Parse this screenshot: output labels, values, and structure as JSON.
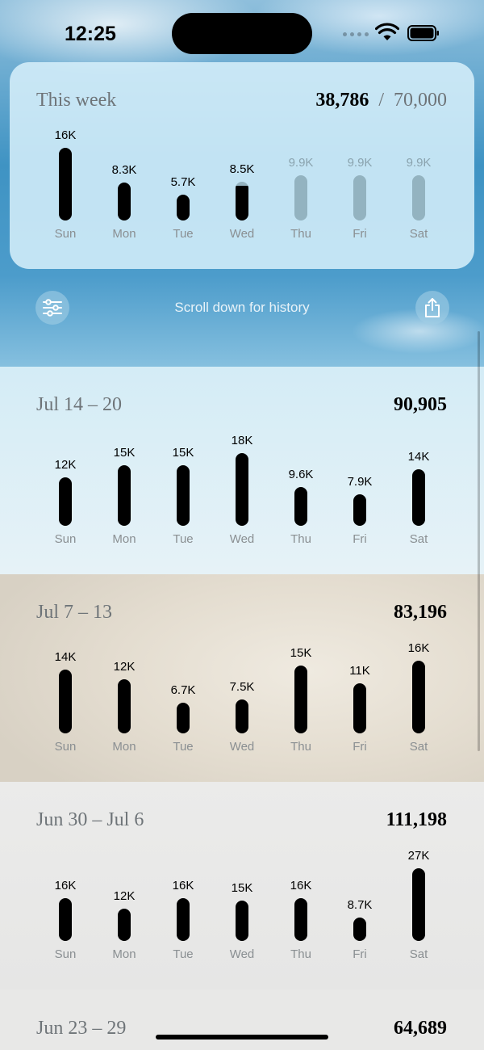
{
  "status": {
    "time": "12:25"
  },
  "this_week": {
    "title": "This week",
    "total": "38,786",
    "separator": "/",
    "goal": "70,000"
  },
  "controls": {
    "filter_icon": "sliders-icon",
    "hint": "Scroll down for history",
    "share_icon": "share-icon"
  },
  "colors": {
    "bar": "#000000",
    "future_bar": "#8fa9b3",
    "label_gray": "#6e7478"
  },
  "chart_data": [
    {
      "type": "bar",
      "title": "This week",
      "categories": [
        "Sun",
        "Mon",
        "Tue",
        "Wed",
        "Thu",
        "Fri",
        "Sat"
      ],
      "values": [
        16000,
        8300,
        5700,
        8500,
        9900,
        9900,
        9900
      ],
      "labels": [
        "16K",
        "8.3K",
        "5.7K",
        "8.5K",
        "9.9K",
        "9.9K",
        "9.9K"
      ],
      "projected": [
        false,
        false,
        false,
        false,
        true,
        true,
        true
      ]
    },
    {
      "type": "bar",
      "title": "Jul 14 – 20",
      "total": "90,905",
      "categories": [
        "Sun",
        "Mon",
        "Tue",
        "Wed",
        "Thu",
        "Fri",
        "Sat"
      ],
      "values": [
        12000,
        15000,
        15000,
        18000,
        9600,
        7900,
        14000
      ],
      "labels": [
        "12K",
        "15K",
        "15K",
        "18K",
        "9.6K",
        "7.9K",
        "14K"
      ]
    },
    {
      "type": "bar",
      "title": "Jul 7 – 13",
      "total": "83,196",
      "categories": [
        "Sun",
        "Mon",
        "Tue",
        "Wed",
        "Thu",
        "Fri",
        "Sat"
      ],
      "values": [
        14000,
        12000,
        6700,
        7500,
        15000,
        11000,
        16000
      ],
      "labels": [
        "14K",
        "12K",
        "6.7K",
        "7.5K",
        "15K",
        "11K",
        "16K"
      ]
    },
    {
      "type": "bar",
      "title": "Jun 30 – Jul 6",
      "total": "111,198",
      "categories": [
        "Sun",
        "Mon",
        "Tue",
        "Wed",
        "Thu",
        "Fri",
        "Sat"
      ],
      "values": [
        16000,
        12000,
        16000,
        15000,
        16000,
        8700,
        27000
      ],
      "labels": [
        "16K",
        "12K",
        "16K",
        "15K",
        "16K",
        "8.7K",
        "27K"
      ]
    },
    {
      "type": "bar",
      "title": "Jun 23 – 29",
      "total": "64,689",
      "categories": [],
      "values": [],
      "labels": []
    }
  ]
}
